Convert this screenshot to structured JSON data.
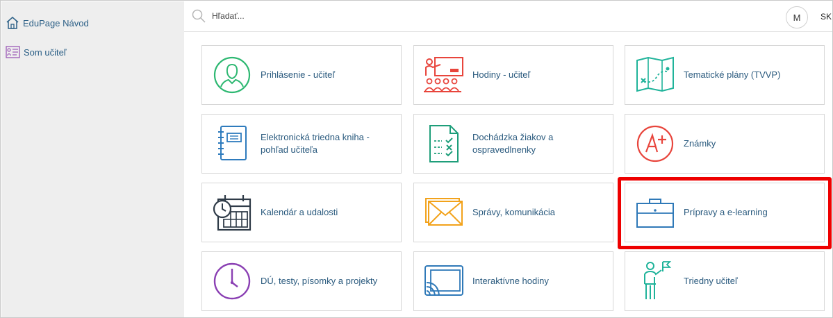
{
  "sidebar": {
    "items": [
      {
        "label": "EduPage Návod",
        "icon": "home-icon"
      },
      {
        "label": "Som učiteľ",
        "icon": "teacher-board-icon"
      }
    ]
  },
  "header": {
    "search_placeholder": "Hľadať...",
    "avatar_initial": "M",
    "language": "SK"
  },
  "tiles": [
    {
      "label": "Prihlásenie - učiteľ",
      "icon": "user-login-icon",
      "color": "#2eb872"
    },
    {
      "label": "Hodiny - učiteľ",
      "icon": "classroom-lesson-icon",
      "color": "#e8453c"
    },
    {
      "label": "Tematické plány (TVVP)",
      "icon": "map-plan-icon",
      "color": "#1fb39a"
    },
    {
      "label": "Elektronická triedna kniha - pohľad učiteľa",
      "icon": "class-book-icon",
      "color": "#2e7bbd"
    },
    {
      "label": "Dochádzka žiakov a ospravedlnenky",
      "icon": "attendance-sheet-icon",
      "color": "#1e9e7a"
    },
    {
      "label": "Známky",
      "icon": "grades-a-plus-icon",
      "color": "#e8453c"
    },
    {
      "label": "Kalendár a udalosti",
      "icon": "calendar-clock-icon",
      "color": "#2f3b48"
    },
    {
      "label": "Správy, komunikácia",
      "icon": "envelope-icon",
      "color": "#f2a21b"
    },
    {
      "label": "Prípravy a e-learning",
      "icon": "briefcase-icon",
      "color": "#2f79b8",
      "highlighted": true
    },
    {
      "label": "DÚ, testy, písomky a projekty",
      "icon": "clock-icon",
      "color": "#8a3fb3"
    },
    {
      "label": "Interaktívne hodiny",
      "icon": "cast-screen-icon",
      "color": "#2f79b8"
    },
    {
      "label": "Triedny učiteľ",
      "icon": "class-teacher-flag-icon",
      "color": "#1fb39a"
    }
  ]
}
